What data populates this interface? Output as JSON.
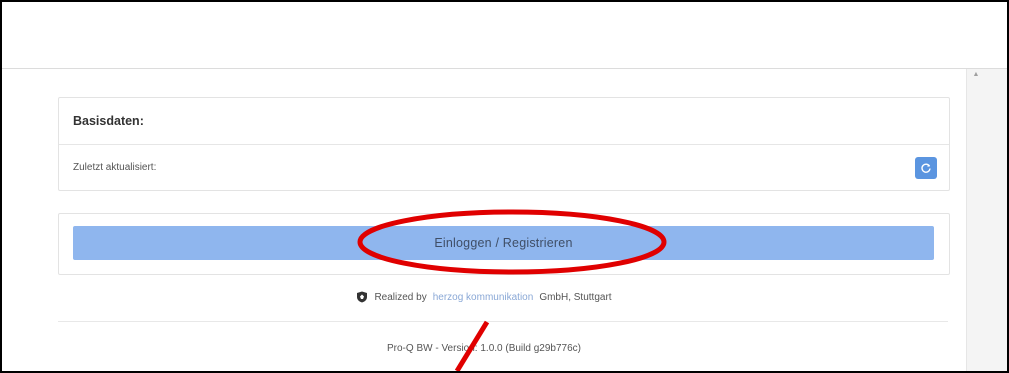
{
  "basisdaten": {
    "title": "Basisdaten:",
    "last_updated_label": "Zuletzt aktualisiert:",
    "refresh_icon": "refresh-icon"
  },
  "login": {
    "button_label": "Einloggen / Registrieren"
  },
  "footer": {
    "realized_prefix": "Realized by",
    "agency_name": "herzog kommunikation",
    "realized_suffix": "GmbH, Stuttgart",
    "version_text": "Pro-Q BW - Version: 1.0.0 (Build g29b776c)"
  },
  "colors": {
    "primary_button": "#8fb6ee",
    "refresh_button": "#5b95e0",
    "annotation_red": "#e00000"
  }
}
